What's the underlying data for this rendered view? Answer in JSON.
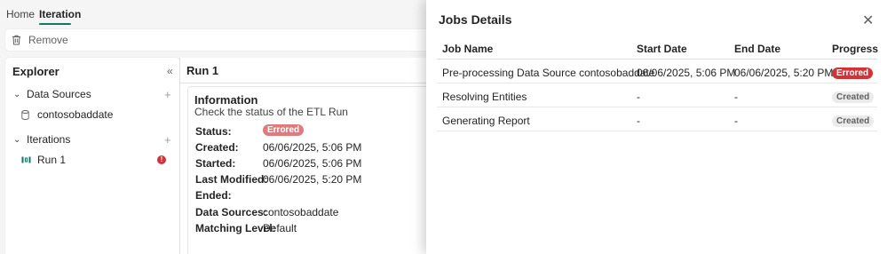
{
  "tabs": [
    {
      "label": "Home"
    },
    {
      "label": "Iteration"
    }
  ],
  "toolbar": {
    "remove_label": "Remove"
  },
  "explorer": {
    "title": "Explorer",
    "data_sources": {
      "label": "Data Sources",
      "items": [
        {
          "label": "contosobaddate"
        }
      ]
    },
    "iterations": {
      "label": "Iterations",
      "items": [
        {
          "label": "Run 1",
          "badge": "!"
        }
      ]
    }
  },
  "run": {
    "title": "Run 1",
    "info_title": "Information",
    "info_subtitle": "Check the status of the ETL Run",
    "fields": [
      {
        "label": "Status:",
        "value": "Errored"
      },
      {
        "label": "Created:",
        "value": "06/06/2025, 5:06 PM"
      },
      {
        "label": "Started:",
        "value": "06/06/2025, 5:06 PM"
      },
      {
        "label": "Last Modified:",
        "value": "06/06/2025, 5:20 PM"
      },
      {
        "label": "Ended:",
        "value": ""
      },
      {
        "label": "Data Sources:",
        "value": "contosobaddate"
      },
      {
        "label": "Matching Level:",
        "value": "Default"
      }
    ]
  },
  "jobs_panel": {
    "title": "Jobs Details",
    "columns": [
      "Job Name",
      "Start Date",
      "End Date",
      "Progress"
    ],
    "rows": [
      {
        "name": "Pre-processing Data Source contosobaddate",
        "start": "06/06/2025, 5:06 PM",
        "end": "06/06/2025, 5:20 PM",
        "progress": "Errored"
      },
      {
        "name": "Resolving Entities",
        "start": "-",
        "end": "-",
        "progress": "Created"
      },
      {
        "name": "Generating Report",
        "start": "-",
        "end": "-",
        "progress": "Created"
      }
    ]
  },
  "colors": {
    "accent": "#117865",
    "error": "#d13438"
  },
  "icons": [
    "trash-icon",
    "collapse-panel-icon",
    "chevron-down-icon",
    "database-icon",
    "add-icon",
    "iteration-icon",
    "error-badge-icon",
    "close-icon"
  ]
}
